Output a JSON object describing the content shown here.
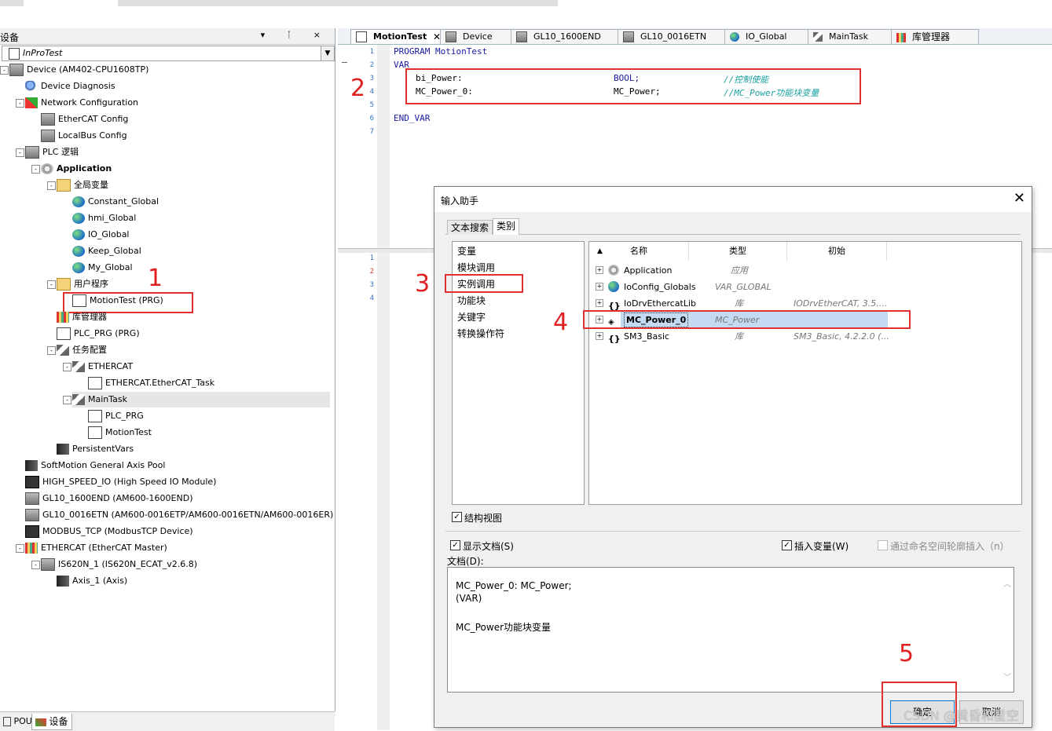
{
  "left_panel": {
    "title": "设备",
    "pin_buttons": "▾ ᛙ ×",
    "project": "InProTest",
    "tree": [
      {
        "label": "Device (AM402-CPU1608TP)",
        "icon": "device-icon"
      },
      {
        "label": "Device Diagnosis",
        "icon": "search-icon"
      },
      {
        "label": "Network Configuration",
        "icon": "network-icon"
      },
      {
        "label": "EtherCAT Config",
        "icon": "device-icon"
      },
      {
        "label": "LocalBus Config",
        "icon": "device-icon"
      },
      {
        "label": "PLC 逻辑",
        "icon": "plc-icon"
      },
      {
        "label": "Application",
        "icon": "gear-icon"
      },
      {
        "label": "全局变量",
        "icon": "folder-icon"
      },
      {
        "label": "Constant_Global",
        "icon": "globe-icon"
      },
      {
        "label": "hmi_Global",
        "icon": "globe-icon"
      },
      {
        "label": "IO_Global",
        "icon": "globe-icon"
      },
      {
        "label": "Keep_Global",
        "icon": "globe-icon"
      },
      {
        "label": "My_Global",
        "icon": "globe-icon"
      },
      {
        "label": "用户程序",
        "icon": "folder-icon"
      },
      {
        "label": "MotionTest (PRG)",
        "icon": "document-icon"
      },
      {
        "label": "库管理器",
        "icon": "library-icon"
      },
      {
        "label": "PLC_PRG (PRG)",
        "icon": "document-icon"
      },
      {
        "label": "任务配置",
        "icon": "task-config-icon"
      },
      {
        "label": "ETHERCAT",
        "icon": "task-icon"
      },
      {
        "label": "ETHERCAT.EtherCAT_Task",
        "icon": "program-call-icon"
      },
      {
        "label": "MainTask",
        "icon": "task-icon"
      },
      {
        "label": "PLC_PRG",
        "icon": "program-call-icon"
      },
      {
        "label": "MotionTest",
        "icon": "program-call-icon"
      },
      {
        "label": "PersistentVars",
        "icon": "persistent-icon"
      },
      {
        "label": "SoftMotion General Axis Pool",
        "icon": "axis-pool-icon"
      },
      {
        "label": "HIGH_SPEED_IO (High Speed IO Module)",
        "icon": "chip-icon"
      },
      {
        "label": "GL10_1600END (AM600-1600END)",
        "icon": "device-icon"
      },
      {
        "label": "GL10_0016ETN (AM600-0016ETP/AM600-0016ETN/AM600-0016ER)",
        "icon": "device-icon"
      },
      {
        "label": "MODBUS_TCP (ModbusTCP Device)",
        "icon": "monitor-icon"
      },
      {
        "label": "ETHERCAT (EtherCAT Master)",
        "icon": "ethercat-master-icon"
      },
      {
        "label": "IS620N_1 (IS620N_ECAT_v2.6.8)",
        "icon": "device-icon"
      },
      {
        "label": "Axis_1 (Axis)",
        "icon": "axis-icon"
      }
    ],
    "bottom_tabs": [
      "POUs",
      "设备"
    ]
  },
  "editor": {
    "tabs": [
      "MotionTest",
      "Device",
      "GL10_1600END",
      "GL10_0016ETN",
      "IO_Global",
      "MainTask",
      "库管理器"
    ],
    "line_numbers": [
      "1",
      "2",
      "3",
      "4",
      "5",
      "6",
      "7"
    ],
    "code": {
      "l1": "PROGRAM MotionTest",
      "l2": "VAR",
      "l3_name": "bi_Power:",
      "l3_type": "BOOL;",
      "l3_comment": "//控制使能",
      "l4_name": "MC_Power_0:",
      "l4_type": "MC_Power;",
      "l4_comment": "//MC_Power功能块变量",
      "l6": "END_VAR"
    },
    "lower_line_numbers": [
      "1",
      "2",
      "3",
      "4"
    ]
  },
  "dialog": {
    "title": "输入助手",
    "close": "✕",
    "tabs": [
      "文本搜索",
      "类别"
    ],
    "categories": [
      "变量",
      "模块调用",
      "实例调用",
      "功能块",
      "关键字",
      "转换操作符"
    ],
    "columns": [
      "名称",
      "类型",
      "初始"
    ],
    "sort_arrow": "▲",
    "rows": [
      {
        "name": "Application",
        "type": "应用",
        "init": ""
      },
      {
        "name": "IoConfig_Globals",
        "type": "VAR_GLOBAL",
        "init": ""
      },
      {
        "name": "IoDrvEthercatLib",
        "type": "库",
        "init": "IODrvEtherCAT, 3.5...."
      },
      {
        "name": "MC_Power_0",
        "type": "MC_Power",
        "init": ""
      },
      {
        "name": "SM3_Basic",
        "type": "库",
        "init": "SM3_Basic, 4.2.2.0 (..."
      }
    ],
    "structured_view": "结构视图",
    "show_doc": "显示文档(S)",
    "insert_var": "插入变量(W)",
    "namespace_insert": "通过命名空间轮廓插入（n）",
    "doc_label": "文档(D):",
    "doc_lines": [
      "MC_Power_0: MC_Power;",
      "(VAR)",
      "",
      "MC_Power功能块变量"
    ],
    "ok": "确定",
    "cancel": "取消"
  },
  "annotations": [
    "1",
    "2",
    "3",
    "4",
    "5"
  ],
  "watermark": "CSDN @黄昏和星空",
  "colors": {
    "annotation": "#e03030",
    "keyword": "#1a1aa6",
    "comment": "#1aa0a0",
    "selection": "#c4daf2"
  }
}
